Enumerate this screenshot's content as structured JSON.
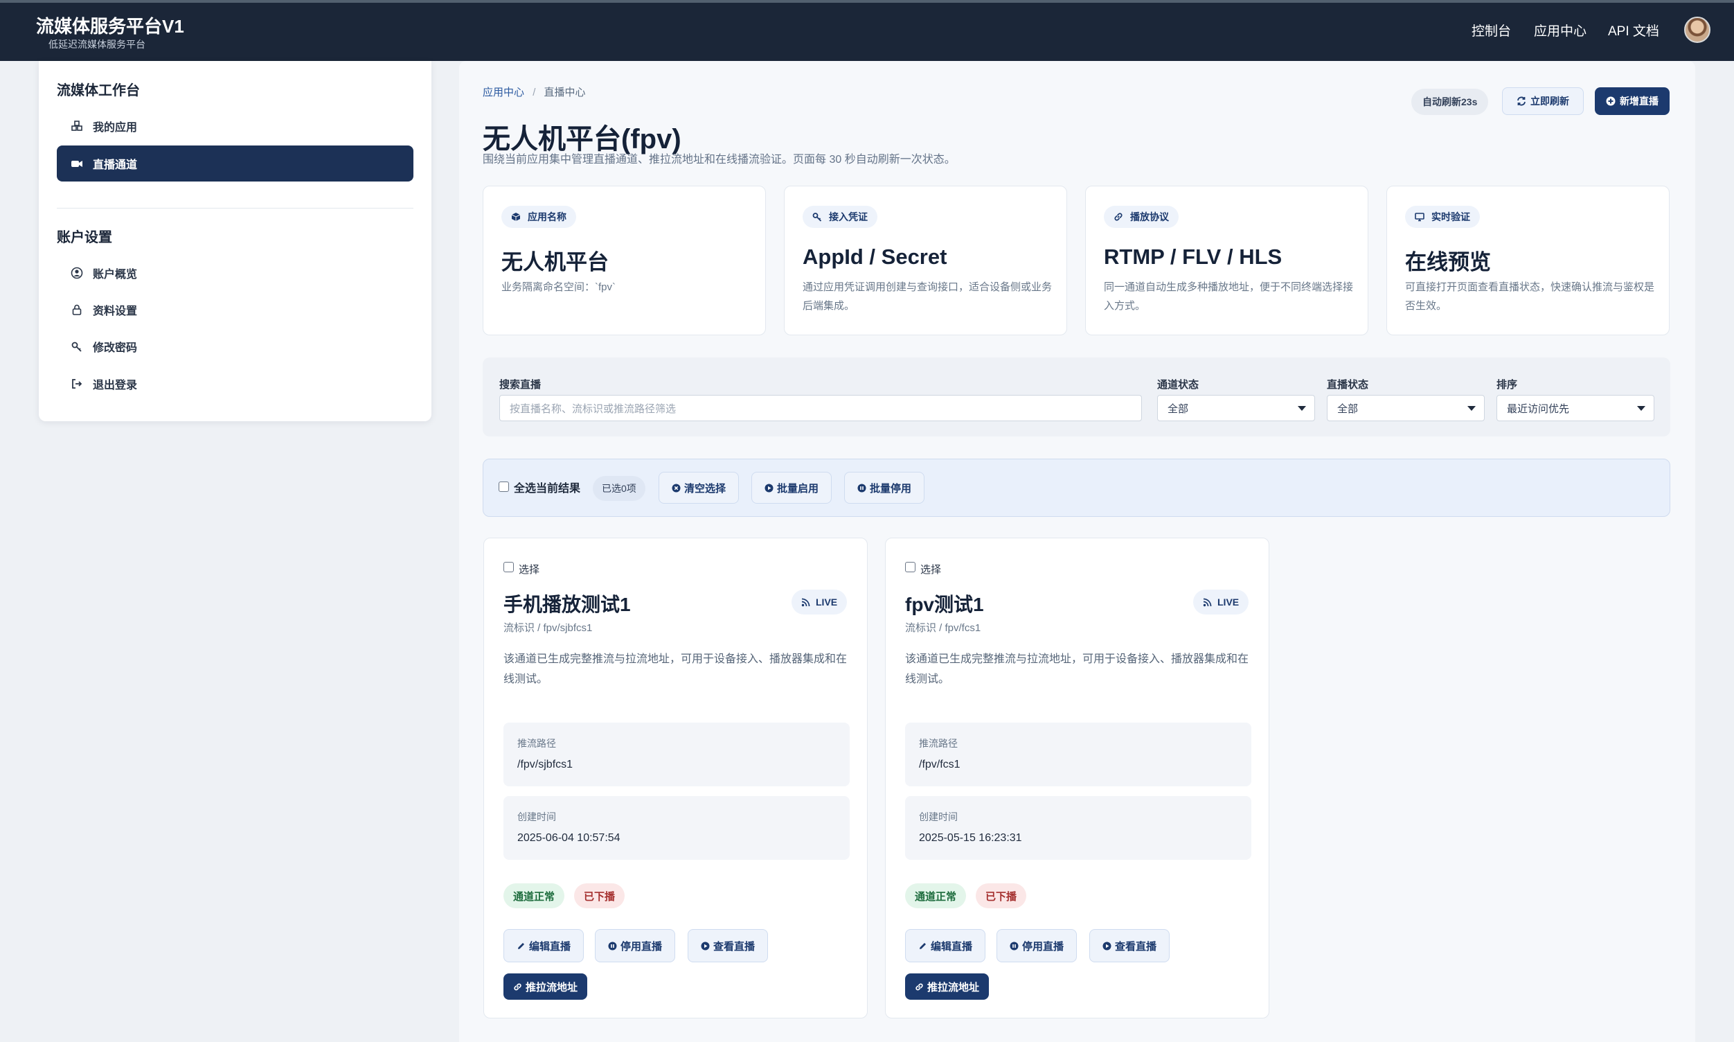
{
  "header": {
    "title": "流媒体服务平台V1",
    "subtitle": "低延迟流媒体服务平台",
    "nav": [
      "控制台",
      "应用中心",
      "API 文档"
    ]
  },
  "sidebar": {
    "workspace_heading": "流媒体工作台",
    "workspace_items": [
      {
        "label": "我的应用",
        "icon": "cubes-icon"
      },
      {
        "label": "直播通道",
        "icon": "video-camera-icon",
        "active": true
      }
    ],
    "account_heading": "账户设置",
    "account_items": [
      {
        "label": "账户概览",
        "icon": "user-circle-icon"
      },
      {
        "label": "资料设置",
        "icon": "lock-icon"
      },
      {
        "label": "修改密码",
        "icon": "key-icon"
      },
      {
        "label": "退出登录",
        "icon": "sign-out-icon"
      }
    ]
  },
  "main": {
    "breadcrumb": {
      "parent": "应用中心",
      "separator": "/",
      "current": "直播中心"
    },
    "auto_refresh": "自动刷新23s",
    "refresh_button": "立即刷新",
    "new_button": "新增直播",
    "title": "无人机平台(fpv)",
    "description": "围绕当前应用集中管理直播通道、推拉流地址和在线播流验证。页面每 30 秒自动刷新一次状态。",
    "features": [
      {
        "badge": "应用名称",
        "icon": "cube-icon",
        "title": "无人机平台",
        "desc": "业务隔离命名空间：`fpv`"
      },
      {
        "badge": "接入凭证",
        "icon": "key-icon",
        "title": "AppId / Secret",
        "desc": "通过应用凭证调用创建与查询接口，适合设备侧或业务后端集成。"
      },
      {
        "badge": "播放协议",
        "icon": "link-icon",
        "title": "RTMP / FLV / HLS",
        "desc": "同一通道自动生成多种播放地址，便于不同终端选择接入方式。"
      },
      {
        "badge": "实时验证",
        "icon": "monitor-icon",
        "title": "在线预览",
        "desc": "可直接打开页面查看直播状态，快速确认推流与鉴权是否生效。"
      }
    ],
    "filters": {
      "search_label": "搜索直播",
      "search_placeholder": "按直播名称、流标识或推流路径筛选",
      "channel_label": "通道状态",
      "channel_value": "全部",
      "live_label": "直播状态",
      "live_value": "全部",
      "sort_label": "排序",
      "sort_value": "最近访问优先"
    },
    "bulk": {
      "select_all": "全选当前结果",
      "selected": "已选0项",
      "clear": "清空选择",
      "enable": "批量启用",
      "disable": "批量停用"
    }
  },
  "streams": [
    {
      "select_label": "选择",
      "name": "手机播放测试1",
      "live_badge": "LIVE",
      "key": "流标识 / fpv/sjbfcs1",
      "desc": "该通道已生成完整推流与拉流地址，可用于设备接入、播放器集成和在线测试。",
      "push_label": "推流路径",
      "push_path": "/fpv/sjbfcs1",
      "created_label": "创建时间",
      "created_at": "2025-06-04 10:57:54",
      "channel_status": "通道正常",
      "live_status": "已下播",
      "edit": "编辑直播",
      "stop": "停用直播",
      "view": "查看直播",
      "urls": "推拉流地址"
    },
    {
      "select_label": "选择",
      "name": "fpv测试1",
      "live_badge": "LIVE",
      "key": "流标识 / fpv/fcs1",
      "desc": "该通道已生成完整推流与拉流地址，可用于设备接入、播放器集成和在线测试。",
      "push_label": "推流路径",
      "push_path": "/fpv/fcs1",
      "created_label": "创建时间",
      "created_at": "2025-05-15 16:23:31",
      "channel_status": "通道正常",
      "live_status": "已下播",
      "edit": "编辑直播",
      "stop": "停用直播",
      "view": "查看直播",
      "urls": "推拉流地址"
    }
  ],
  "colors": {
    "header_bg": "#1b2638",
    "accent": "#1c3a6e",
    "ok_bg": "#e3f5ea",
    "off_bg": "#fbe7e7"
  }
}
